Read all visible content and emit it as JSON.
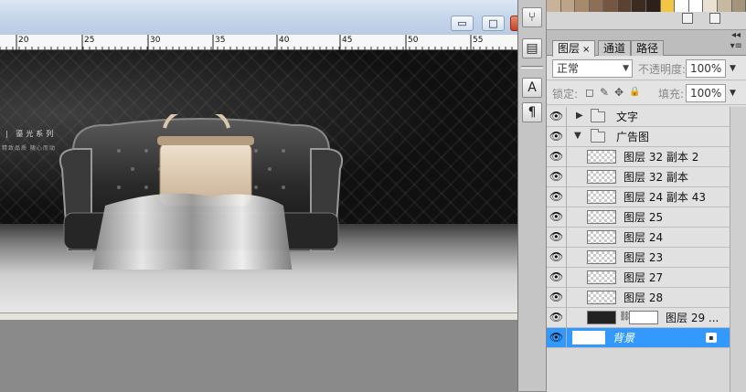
{
  "ruler": {
    "labels": [
      "20",
      "25",
      "30",
      "35",
      "40",
      "45",
      "50",
      "55"
    ]
  },
  "window_controls": {
    "minimize": "▭",
    "maximize": "□",
    "close": ""
  },
  "canvas": {
    "text_line_1": "| 鎏光系列",
    "text_line_2": "精致品质 随心而动"
  },
  "swatches": [
    "#c9b299",
    "#bda486",
    "#a78a6c",
    "#8c6f55",
    "#745641",
    "#5a4131",
    "#3c2b21",
    "#2b201a",
    "#f4c542",
    "#ffffff",
    "#ffffff",
    "#e9e2d2",
    "#c7b8a0",
    "#a5947c"
  ],
  "tool_strip": {
    "tools": [
      {
        "name": "usb-icon",
        "glyph": "⑂"
      },
      {
        "name": "clone-source-icon",
        "glyph": "▤"
      },
      {
        "name": "character-panel-icon",
        "glyph": "A"
      },
      {
        "name": "paragraph-panel-icon",
        "glyph": "¶"
      }
    ]
  },
  "layers_panel": {
    "tabs": [
      {
        "label": "图层",
        "close": "×"
      },
      {
        "label": "通道"
      },
      {
        "label": "路径"
      }
    ],
    "collapse_glyph": "◂◂",
    "menu_glyph": "▾≡",
    "blend_mode": "正常",
    "opacity_label": "不透明度:",
    "opacity_value": "100%",
    "lock_label": "锁定:",
    "lock_icons": [
      "◻",
      "✎",
      "✥",
      "🔒"
    ],
    "fill_label": "填充:",
    "fill_value": "100%",
    "dropdown_arrow": "▼",
    "eye_glyph": "👁",
    "layers": [
      {
        "name": "文字",
        "type": "group",
        "expanded": false
      },
      {
        "name": "广告图",
        "type": "group",
        "expanded": true
      },
      {
        "name": "图层 32 副本 2",
        "type": "layer"
      },
      {
        "name": "图层 32 副本",
        "type": "layer"
      },
      {
        "name": "图层 24 副本 43",
        "type": "layer"
      },
      {
        "name": "图层 25",
        "type": "layer"
      },
      {
        "name": "图层 24",
        "type": "layer"
      },
      {
        "name": "图层 23",
        "type": "layer"
      },
      {
        "name": "图层 27",
        "type": "layer"
      },
      {
        "name": "图层 28",
        "type": "layer"
      },
      {
        "name": "图层 29 ...",
        "type": "masked"
      },
      {
        "name": "背景",
        "type": "background",
        "selected": true,
        "locked": true
      }
    ]
  },
  "colors": {
    "selection": "#3399ff",
    "panel": "#d7d7d7"
  }
}
